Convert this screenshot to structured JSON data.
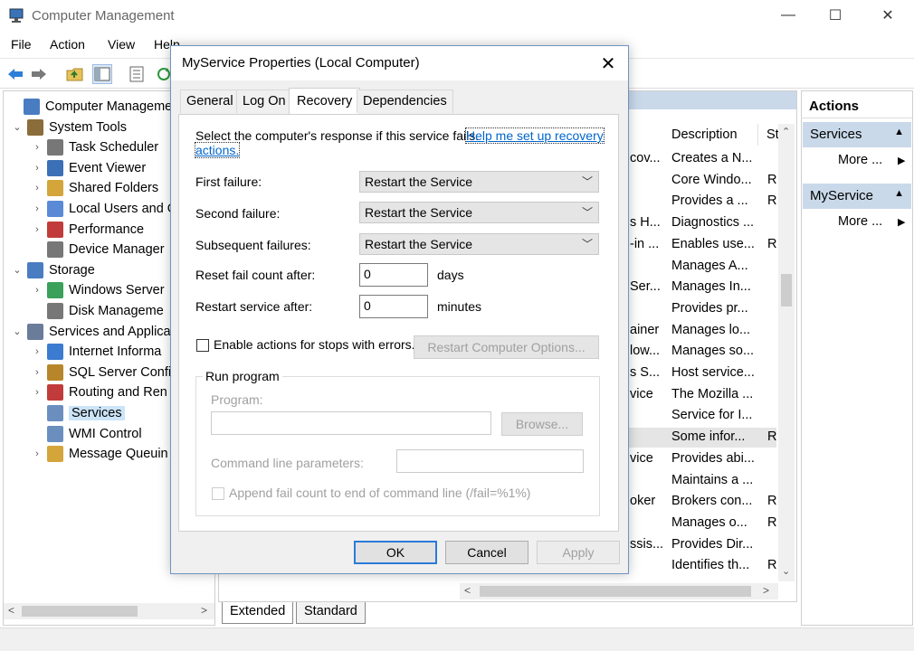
{
  "window": {
    "title": "Computer Management",
    "controls": {
      "minimize": "—",
      "maximize": "☐",
      "close": "✕"
    }
  },
  "menu": [
    "File",
    "Action",
    "View",
    "Help"
  ],
  "toolbar_icons": [
    "back-arrow-icon",
    "forward-arrow-icon",
    "folder-up-icon",
    "show-hide-tree-icon",
    "properties-icon",
    "refresh-icon"
  ],
  "tree": [
    {
      "label": "Computer Management",
      "level": 0,
      "chevron": "",
      "icon": "computer-icon"
    },
    {
      "label": "System Tools",
      "level": 1,
      "chevron": "⌄",
      "icon": "tools-icon"
    },
    {
      "label": "Task Scheduler",
      "level": 2,
      "chevron": "›",
      "icon": "clock-icon"
    },
    {
      "label": "Event Viewer",
      "level": 2,
      "chevron": "›",
      "icon": "event-viewer-icon"
    },
    {
      "label": "Shared Folders",
      "level": 2,
      "chevron": "›",
      "icon": "shared-folder-icon"
    },
    {
      "label": "Local Users and G",
      "level": 2,
      "chevron": "›",
      "icon": "users-icon"
    },
    {
      "label": "Performance",
      "level": 2,
      "chevron": "›",
      "icon": "performance-icon"
    },
    {
      "label": "Device Manager",
      "level": 2,
      "chevron": "",
      "icon": "device-manager-icon"
    },
    {
      "label": "Storage",
      "level": 1,
      "chevron": "⌄",
      "icon": "storage-icon"
    },
    {
      "label": "Windows Server",
      "level": 2,
      "chevron": "›",
      "icon": "windows-server-backup-icon"
    },
    {
      "label": "Disk Manageme",
      "level": 2,
      "chevron": "",
      "icon": "disk-icon"
    },
    {
      "label": "Services and Applica",
      "level": 1,
      "chevron": "⌄",
      "icon": "services-apps-icon"
    },
    {
      "label": "Internet Informa",
      "level": 2,
      "chevron": "›",
      "icon": "iis-icon"
    },
    {
      "label": "SQL Server Confi",
      "level": 2,
      "chevron": "›",
      "icon": "sql-server-icon"
    },
    {
      "label": "Routing and Ren",
      "level": 2,
      "chevron": "›",
      "icon": "routing-icon"
    },
    {
      "label": "Services",
      "level": 2,
      "chevron": "",
      "icon": "services-icon",
      "selected": true
    },
    {
      "label": "WMI Control",
      "level": 2,
      "chevron": "",
      "icon": "wmi-icon"
    },
    {
      "label": "Message Queuin",
      "level": 2,
      "chevron": "›",
      "icon": "message-queue-icon"
    }
  ],
  "services_table": {
    "columns": [
      "Description",
      "St"
    ],
    "rows": [
      {
        "name_tail": "cov...",
        "description": "Creates a N...",
        "status": ""
      },
      {
        "name_tail": "",
        "description": "Core Windo...",
        "status": "R"
      },
      {
        "name_tail": "",
        "description": "Provides a ...",
        "status": "R"
      },
      {
        "name_tail": "s H...",
        "description": "Diagnostics ...",
        "status": ""
      },
      {
        "name_tail": "-in ...",
        "description": "Enables use...",
        "status": "R"
      },
      {
        "name_tail": "",
        "description": "Manages A...",
        "status": ""
      },
      {
        "name_tail": "Ser...",
        "description": "Manages In...",
        "status": ""
      },
      {
        "name_tail": "",
        "description": "Provides pr...",
        "status": ""
      },
      {
        "name_tail": "ainer",
        "description": "Manages lo...",
        "status": ""
      },
      {
        "name_tail": "low...",
        "description": "Manages so...",
        "status": ""
      },
      {
        "name_tail": "s S...",
        "description": "Host service...",
        "status": ""
      },
      {
        "name_tail": "vice",
        "description": "The Mozilla ...",
        "status": ""
      },
      {
        "name_tail": "",
        "description": "Service for I...",
        "status": ""
      },
      {
        "name_tail": "",
        "description": "Some infor...",
        "status": "R",
        "selected": true
      },
      {
        "name_tail": "vice",
        "description": "Provides abi...",
        "status": ""
      },
      {
        "name_tail": "",
        "description": "Maintains a ...",
        "status": ""
      },
      {
        "name_tail": "oker",
        "description": "Brokers con...",
        "status": "R"
      },
      {
        "name_tail": "",
        "description": "Manages o...",
        "status": "R"
      },
      {
        "name_tail": "ssis...",
        "description": "Provides Dir...",
        "status": ""
      },
      {
        "name_tail": "",
        "description": "Identifies th...",
        "status": "R"
      }
    ]
  },
  "bottom_tabs": [
    "Extended",
    "Standard"
  ],
  "actions": {
    "title": "Actions",
    "sections": [
      {
        "header": "Services",
        "item": "More ..."
      },
      {
        "header": "MyService",
        "item": "More ..."
      }
    ]
  },
  "dialog": {
    "title": "MyService Properties (Local Computer)",
    "tabs": [
      "General",
      "Log On",
      "Recovery",
      "Dependencies"
    ],
    "active_tab": "Recovery",
    "intro": "Select the computer's response if this service fails.",
    "help_link_1": "Help me set up recovery",
    "help_link_2": "actions.",
    "first_failure_label": "First failure:",
    "first_failure_value": "Restart the Service",
    "second_failure_label": "Second failure:",
    "second_failure_value": "Restart the Service",
    "subsequent_label": "Subsequent failures:",
    "subsequent_value": "Restart the Service",
    "reset_label": "Reset fail count after:",
    "reset_value": "0",
    "reset_unit": "days",
    "restart_label": "Restart service after:",
    "restart_value": "0",
    "restart_unit": "minutes",
    "enable_actions_label": "Enable actions for stops with errors.",
    "restart_computer_btn": "Restart Computer Options...",
    "run_program_group": "Run program",
    "program_label": "Program:",
    "browse_btn": "Browse...",
    "cmdline_label": "Command line parameters:",
    "append_label": "Append fail count to end of command line (/fail=%1%)",
    "ok_btn": "OK",
    "cancel_btn": "Cancel",
    "apply_btn": "Apply"
  }
}
